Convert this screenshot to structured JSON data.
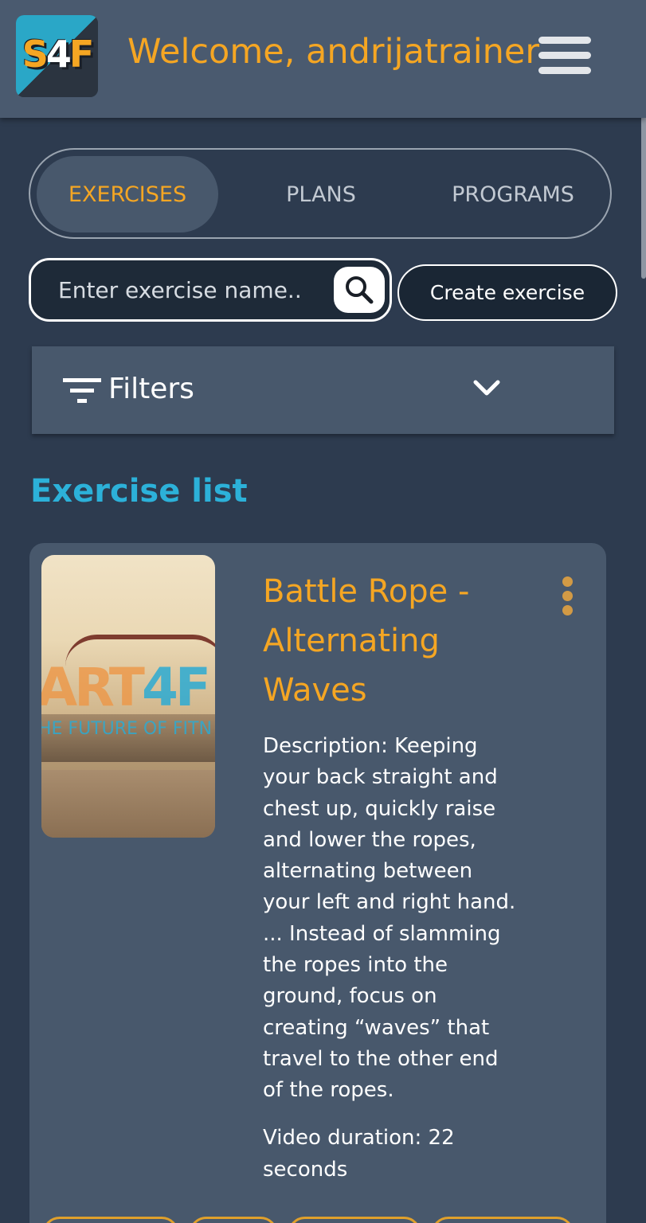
{
  "header": {
    "logo_text": "S4F",
    "welcome_text": "Welcome, andrijatrainer"
  },
  "tabs": [
    {
      "label": "EXERCISES",
      "active": true
    },
    {
      "label": "PLANS",
      "active": false
    },
    {
      "label": "PROGRAMS",
      "active": false
    }
  ],
  "search": {
    "placeholder": "Enter exercise name..",
    "value": ""
  },
  "create_button_label": "Create exercise",
  "filters": {
    "label": "Filters"
  },
  "section_title": "Exercise list",
  "exercises": [
    {
      "title": "Battle Rope - Alternating Waves",
      "description": "Description: Keeping your back straight and chest up, quickly raise and lower the ropes, alternating between your left and right hand. ... Instead of slamming the ropes into the ground, focus on creating “waves” that travel to the other end of the ropes.",
      "duration": "Video duration: 22 seconds",
      "thumbnail_watermark": "ART4F",
      "thumbnail_tagline": "HE FUTURE OF FITN"
    }
  ],
  "colors": {
    "background": "#2d3b4f",
    "surface": "#48586c",
    "accent": "#f5a623",
    "title_blue": "#2cb1d9"
  }
}
